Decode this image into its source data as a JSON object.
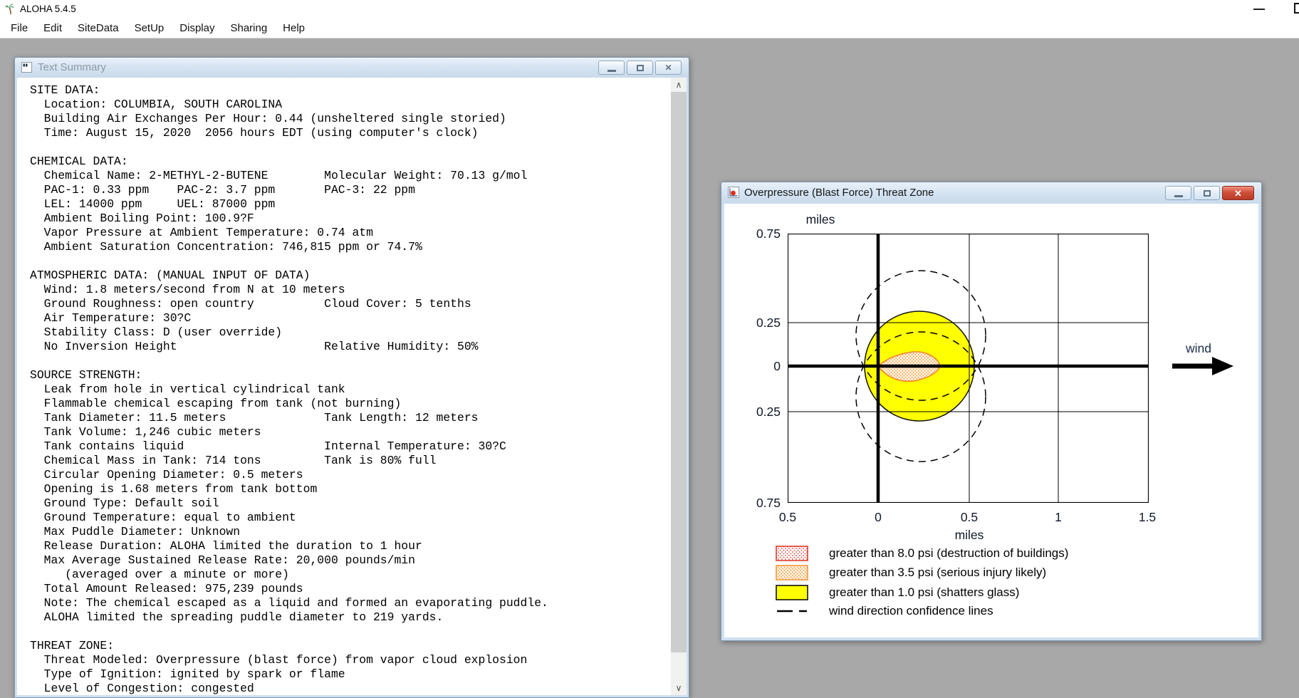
{
  "app": {
    "title": "ALOHA 5.4.5",
    "menu": [
      "File",
      "Edit",
      "SiteData",
      "SetUp",
      "Display",
      "Sharing",
      "Help"
    ]
  },
  "text_summary_window": {
    "title": "Text Summary",
    "content": "SITE DATA:\n  Location: COLUMBIA, SOUTH CAROLINA\n  Building Air Exchanges Per Hour: 0.44 (unsheltered single storied)\n  Time: August 15, 2020  2056 hours EDT (using computer's clock)\n\nCHEMICAL DATA:\n  Chemical Name: 2-METHYL-2-BUTENE        Molecular Weight: 70.13 g/mol\n  PAC-1: 0.33 ppm    PAC-2: 3.7 ppm       PAC-3: 22 ppm\n  LEL: 14000 ppm     UEL: 87000 ppm\n  Ambient Boiling Point: 100.9?F\n  Vapor Pressure at Ambient Temperature: 0.74 atm\n  Ambient Saturation Concentration: 746,815 ppm or 74.7%\n\nATMOSPHERIC DATA: (MANUAL INPUT OF DATA)\n  Wind: 1.8 meters/second from N at 10 meters\n  Ground Roughness: open country          Cloud Cover: 5 tenths\n  Air Temperature: 30?C\n  Stability Class: D (user override)\n  No Inversion Height                     Relative Humidity: 50%\n\nSOURCE STRENGTH:\n  Leak from hole in vertical cylindrical tank\n  Flammable chemical escaping from tank (not burning)\n  Tank Diameter: 11.5 meters              Tank Length: 12 meters\n  Tank Volume: 1,246 cubic meters\n  Tank contains liquid                    Internal Temperature: 30?C\n  Chemical Mass in Tank: 714 tons         Tank is 80% full\n  Circular Opening Diameter: 0.5 meters\n  Opening is 1.68 meters from tank bottom\n  Ground Type: Default soil\n  Ground Temperature: equal to ambient\n  Max Puddle Diameter: Unknown\n  Release Duration: ALOHA limited the duration to 1 hour\n  Max Average Sustained Release Rate: 20,000 pounds/min\n     (averaged over a minute or more)\n  Total Amount Released: 975,239 pounds\n  Note: The chemical escaped as a liquid and formed an evaporating puddle.\n  ALOHA limited the spreading puddle diameter to 219 yards.\n\nTHREAT ZONE:\n  Threat Modeled: Overpressure (blast force) from vapor cloud explosion\n  Type of Ignition: ignited by spark or flame\n  Level of Congestion: congested"
  },
  "threat_zone_window": {
    "title": "Overpressure (Blast Force) Threat Zone",
    "wind_label": "wind"
  },
  "chart_data": {
    "type": "area",
    "title": "Overpressure (Blast Force) Threat Zone",
    "xlabel": "miles",
    "ylabel": "miles",
    "xlim": [
      -0.5,
      1.5
    ],
    "ylim": [
      -0.75,
      0.75
    ],
    "x_tick_labels": [
      "0.5",
      "0",
      "0.5",
      "1",
      "1.5"
    ],
    "y_tick_labels": [
      "0.75",
      "0.25",
      "0",
      "0.25",
      "0.75"
    ],
    "grid": true,
    "legend_position": "bottom",
    "colors": {
      "psi_8_0": "#e23b2e",
      "psi_3_5": "#f08a24",
      "psi_1_0": "#ffff00"
    },
    "zones": [
      {
        "threshold_psi": 8.0,
        "label": "greater than 8.0 psi (destruction of buildings)",
        "swatch": "red-dotted",
        "visible_on_plot": false
      },
      {
        "threshold_psi": 3.5,
        "label": "greater than 3.5 psi (serious injury likely)",
        "swatch": "orange-dotted",
        "shape": "teardrop",
        "downwind_extent_miles": [
          0.0,
          0.34
        ],
        "max_half_width_miles": 0.08
      },
      {
        "threshold_psi": 1.0,
        "label": "greater than 1.0 psi (shatters glass)",
        "swatch": "yellow-solid",
        "shape": "circle",
        "center_miles": [
          0.23,
          0.0
        ],
        "radius_miles": 0.31
      }
    ],
    "confidence_lines": {
      "label": "wind direction confidence lines",
      "style": "dashed",
      "circles": [
        {
          "center_miles": [
            0.24,
            0.17
          ],
          "radius_miles": 0.36
        },
        {
          "center_miles": [
            0.24,
            -0.17
          ],
          "radius_miles": 0.36
        }
      ]
    },
    "wind_annotation": {
      "label": "wind",
      "direction": "left-to-right"
    }
  }
}
